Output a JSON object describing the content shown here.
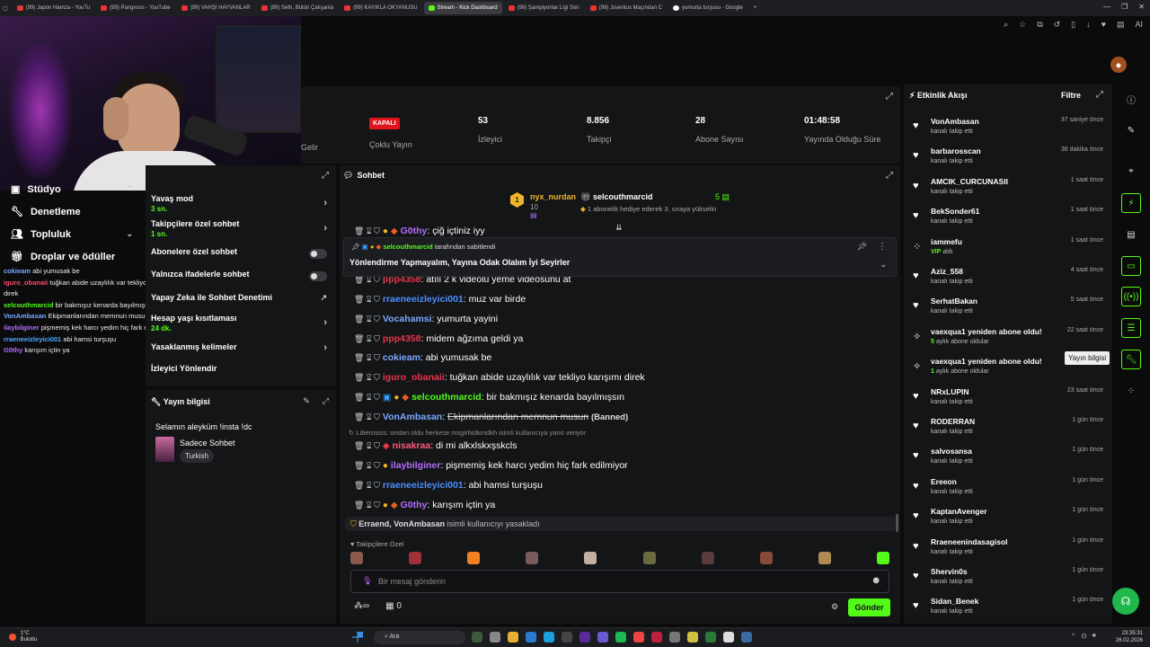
{
  "browser": {
    "tabs": [
      {
        "label": "(99) Japon Hamza - YouTu",
        "fav": "youtube"
      },
      {
        "label": "(99) Pangvoss - YouTube",
        "fav": "youtube"
      },
      {
        "label": "(99) VAHŞİ HAYVANLAR",
        "fav": "youtube"
      },
      {
        "label": "(99) Seth, Bütün Çalışanla",
        "fav": "youtube"
      },
      {
        "label": "(99) KAYIKLA OKYANUSU",
        "fav": "youtube"
      },
      {
        "label": "Stream - Kick Dashboard",
        "fav": "kick"
      },
      {
        "label": "(99) Şampiyonlar Ligi Son",
        "fav": "youtube"
      },
      {
        "label": "(99) Juventus Maçından C",
        "fav": "youtube"
      },
      {
        "label": "yumurta turşusu - Google",
        "fav": "google"
      }
    ],
    "new_tab": "+",
    "ai_label": "AI"
  },
  "stats": {
    "gelir_label": "Gelir",
    "status_badge": "KAPALI",
    "multistream_label": "Çoklu Yayın",
    "viewers_value": "53",
    "viewers_label": "İzleyici",
    "followers_value": "8.856",
    "followers_label": "Takipçi",
    "subs_value": "28",
    "subs_label": "Abone Sayısı",
    "uptime_value": "01:48:58",
    "uptime_label": "Yayında Olduğu Süre"
  },
  "leftnav": {
    "items": [
      {
        "label": "Stüdyo"
      },
      {
        "label": "Denetleme"
      },
      {
        "label": "Topluluk"
      },
      {
        "label": "Droplar ve ödüller"
      }
    ]
  },
  "minichat": [
    {
      "user": "cokieam",
      "color": "#7aa8ff",
      "text": "abi yumusak be"
    },
    {
      "user": "iguro_obanaii",
      "color": "#ff4a6a",
      "text": "tuğkan abide uzaylılık var tekliyo karışımı direk"
    },
    {
      "user": "selcouthmarcid",
      "color": "#53fc18",
      "text": "bir bakmışız kenarda bayılmışsın"
    },
    {
      "user": "VonAmbasan",
      "color": "#7aa8ff",
      "text": "Ekipmanlarından memnun musun"
    },
    {
      "user": "ilaybilginer",
      "color": "#b46cff",
      "text": "pişmemiş kek harcı yedim hiç fark edilmiyor"
    },
    {
      "user": "rraeneeizleyici001",
      "color": "#4aa8ff",
      "text": "abi hamsi turşuşu"
    },
    {
      "user": "G0thy",
      "color": "#b46cff",
      "text": "karışım içtin ya"
    }
  ],
  "settings": {
    "slow_mode": {
      "label": "Yavaş mod",
      "value": "3 sn."
    },
    "followers_only": {
      "label": "Takipçilere özel sohbet",
      "value": "1 sn."
    },
    "subs_only": {
      "label": "Abonelere özel sohbet"
    },
    "emotes_only": {
      "label": "Yalnızca ifadelerle sohbet"
    },
    "ai_moderation": {
      "label": "Yapay Zeka ile Sohbet Denetimi"
    },
    "account_age": {
      "label": "Hesap yaşı kısıtlaması",
      "value": "24 dk."
    },
    "banned_words": {
      "label": "Yasaklanmış kelimeler"
    },
    "redirect": {
      "label": "İzleyici Yönlendir"
    }
  },
  "streaminfo": {
    "header": "Yayın bilgisi",
    "title": "Selamın aleyküm !insta !dc",
    "category": "Sadece Sohbet",
    "tag": "Turkish"
  },
  "chat": {
    "header": "Sohbet",
    "leader1": {
      "name": "nyx_nurdan",
      "count": "10"
    },
    "leader2": {
      "name": "selcouthmarcid",
      "count": "5",
      "note": "1 abonelik hediye ederek 3. sıraya yükselin"
    },
    "pinned": {
      "by_user": "selcouthmarcid",
      "by_suffix": "tarafından sabitlendi",
      "text": "Yönlendirme Yapmayalım, Yayına Odak Olalım İyi Seyirler"
    },
    "messages": [
      {
        "user": "G0thy",
        "color": "#b46cff",
        "text": "çiğ içtiniz iyy",
        "partial": true
      },
      {
        "user": "ppp4358",
        "color": "#e8344e",
        "text": "atılı 2 k videolu yeme videosunu at",
        "partial": true
      },
      {
        "user": "rraeneeizleyici001",
        "color": "#4a90ff",
        "text": "muz var birde"
      },
      {
        "user": "Vocahamsi",
        "color": "#7aa8ff",
        "text": "yumurta yayini"
      },
      {
        "user": "ppp4358",
        "color": "#e8344e",
        "text": "midem ağzıma geldi ya"
      },
      {
        "user": "cokieam",
        "color": "#7aa8ff",
        "text": "abi yumusak be"
      },
      {
        "user": "iguro_obanaii",
        "color": "#e8344e",
        "text": "tuğkan abide uzaylılık var tekliyo karışımı direk"
      },
      {
        "user": "selcouthmarcid",
        "color": "#53fc18",
        "text": "bir bakmışız kenarda bayılmışsın"
      },
      {
        "user": "VonAmbasan",
        "color": "#7aa8ff",
        "text": "Ekipmanlarından memnun musun",
        "banned": "(Banned)"
      },
      {
        "user": "nisakraa",
        "color": "#ff5a7a",
        "text": "di mi alkxlskxşskcls"
      },
      {
        "user": "ilaybilginer",
        "color": "#b46cff",
        "text": "pişmemiş kek harcı yedim hiç fark edilmiyor"
      },
      {
        "user": "rraeneeizleyici001",
        "color": "#4a90ff",
        "text": "abi hamsi turşuşu"
      },
      {
        "user": "G0thy",
        "color": "#b46cff",
        "text": "karışım içtin ya"
      }
    ],
    "system_note": "Liberosiss: ondan oldu herkese msgirhtdkmdkh isimli kullanıcıya yanıt veriyor",
    "ban_note": {
      "users": "Erraend, VonAmbasan",
      "text": "isimli kullanıcıyı yasakladı"
    },
    "emote_row_label": "Takipçilere Özel",
    "input_placeholder": "Bir mesaj gönderin",
    "points_value": "0",
    "send_label": "Gönder"
  },
  "feed": {
    "header": "Etkinlik Akışı",
    "filter_label": "Filtre",
    "items": [
      {
        "icon": "heart",
        "name": "VonAmbasan",
        "sub": "kanalı takip etti",
        "time": "37 saniye önce"
      },
      {
        "icon": "heart",
        "name": "barbarosscan",
        "sub": "kanalı takip etti",
        "time": "38 dakika önce"
      },
      {
        "icon": "heart",
        "name": "AMCIK_CURCUNASII",
        "sub": "kanalı takip etti",
        "time": "1 saat önce"
      },
      {
        "icon": "heart",
        "name": "BekSonder61",
        "sub": "kanalı takip etti",
        "time": "1 saat önce"
      },
      {
        "icon": "vip",
        "name": "iammefu",
        "sub": "aldı",
        "sub_green": "VIP",
        "time": "1 saat önce"
      },
      {
        "icon": "heart",
        "name": "Aziz_558",
        "sub": "kanalı takip etti",
        "time": "4 saat önce"
      },
      {
        "icon": "heart",
        "name": "SerhatBakan",
        "sub": "kanalı takip etti",
        "time": "5 saat önce"
      },
      {
        "icon": "star",
        "name": "vaexqua1 yeniden abone oldu!",
        "sub": "aylık abone oldular",
        "sub_green": "5",
        "time": "22 saat önce"
      },
      {
        "icon": "star",
        "name": "vaexqua1 yeniden abone oldu!",
        "sub": "aylık abone oldular",
        "sub_green": "1",
        "time": ""
      },
      {
        "icon": "heart",
        "name": "NRxLUPIN",
        "sub": "kanalı takip etti",
        "time": "23 saat önce"
      },
      {
        "icon": "heart",
        "name": "RODERRAN",
        "sub": "kanalı takip etti",
        "time": "1 gün önce"
      },
      {
        "icon": "heart",
        "name": "salvosansa",
        "sub": "kanalı takip etti",
        "time": "1 gün önce"
      },
      {
        "icon": "heart",
        "name": "Ereeon",
        "sub": "kanalı takip etti",
        "time": "1 gün önce"
      },
      {
        "icon": "heart",
        "name": "KaptanAvenger",
        "sub": "kanalı takip etti",
        "time": "1 gün önce"
      },
      {
        "icon": "heart",
        "name": "Rraeneenindasagisol",
        "sub": "kanalı takip etti",
        "time": "1 gün önce"
      },
      {
        "icon": "heart",
        "name": "Shervin0s",
        "sub": "kanalı takip etti",
        "time": "1 gün önce"
      },
      {
        "icon": "heart",
        "name": "Sidan_Benek",
        "sub": "kanalı takip etti",
        "time": "1 gün önce"
      }
    ]
  },
  "rail": {
    "tooltip": "Yayın bilgisi"
  },
  "taskbar": {
    "weather_temp": "1°C",
    "weather_desc": "Bulutlu",
    "search_label": "Ara",
    "time": "23:35:31",
    "date": "26.02.2026"
  },
  "colors": {
    "kick_green": "#53fc18",
    "panel_bg": "#141517",
    "live_red": "#e1141e",
    "gold_badge": "#f0b428"
  }
}
